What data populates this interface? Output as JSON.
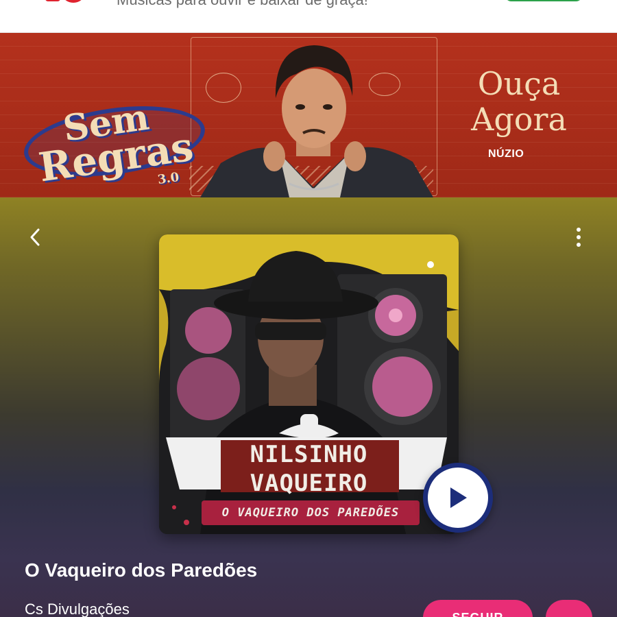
{
  "header": {
    "tagline": "Músicas para ouvir e baixar de graça!",
    "brand_color": "#e0232f",
    "download_color": "#2ca24a"
  },
  "banner": {
    "logo_line1": "Sem",
    "logo_line2": "Regras",
    "logo_version": "3.0",
    "cta_line1": "Ouça",
    "cta_line2": "Agora",
    "artist": "NÚZIO",
    "background_color": "#a82c1a"
  },
  "player": {
    "back_icon": "chevron-left-icon",
    "more_icon": "more-vertical-icon",
    "cover": {
      "artist_line1": "NILSINHO",
      "artist_line2": "VAQUEIRO",
      "album_subtitle": "O VAQUEIRO DOS PAREDÕES"
    },
    "play_icon": "play-icon",
    "album_title": "O Vaqueiro dos Paredões",
    "author": "Cs Divulgações",
    "follow_label": "SEGUIR",
    "accent_color": "#e92d76"
  }
}
